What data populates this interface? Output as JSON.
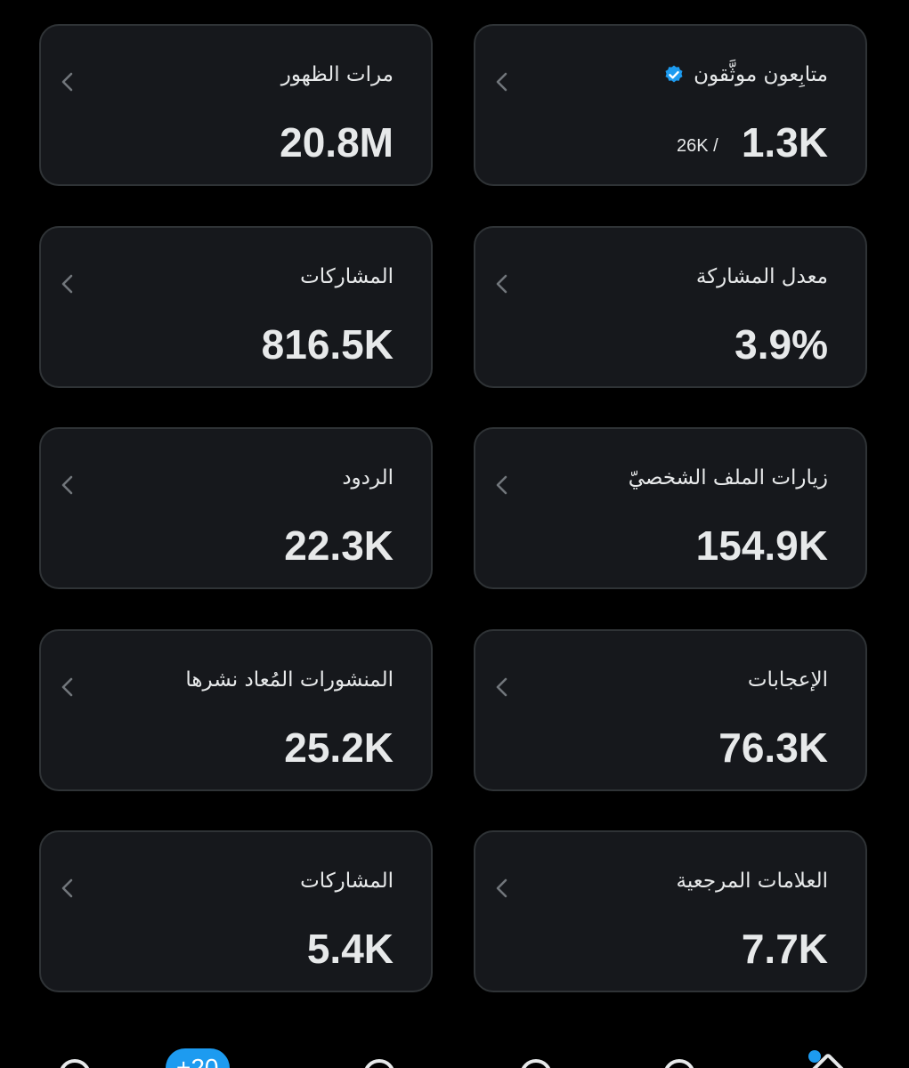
{
  "cards": [
    {
      "label": "متابِعون موثَّقون",
      "value": "1.3K",
      "sub": "26K  /",
      "verified": true
    },
    {
      "label": "مرات الظهور",
      "value": "20.8M"
    },
    {
      "label": "معدل المشاركة",
      "value": "3.9%"
    },
    {
      "label": "المشاركات",
      "value": "816.5K"
    },
    {
      "label": "زيارات الملف الشخصيّ",
      "value": "154.9K"
    },
    {
      "label": "الردود",
      "value": "22.3K"
    },
    {
      "label": "الإعجابات",
      "value": "76.3K"
    },
    {
      "label": "المنشورات المُعاد نشرها",
      "value": "25.2K"
    },
    {
      "label": "العلامات المرجعية",
      "value": "7.7K"
    },
    {
      "label": "المشاركات",
      "value": "5.4K"
    }
  ],
  "nav": {
    "badge": "+20"
  },
  "colors": {
    "accent": "#1d9bf0",
    "card_bg": "#16181c",
    "card_border": "#2f3336",
    "text": "#e7e9ea",
    "chevron": "#71767b"
  },
  "icons": {
    "chevron": "chevron-left-icon",
    "verified": "verified-badge-icon"
  }
}
